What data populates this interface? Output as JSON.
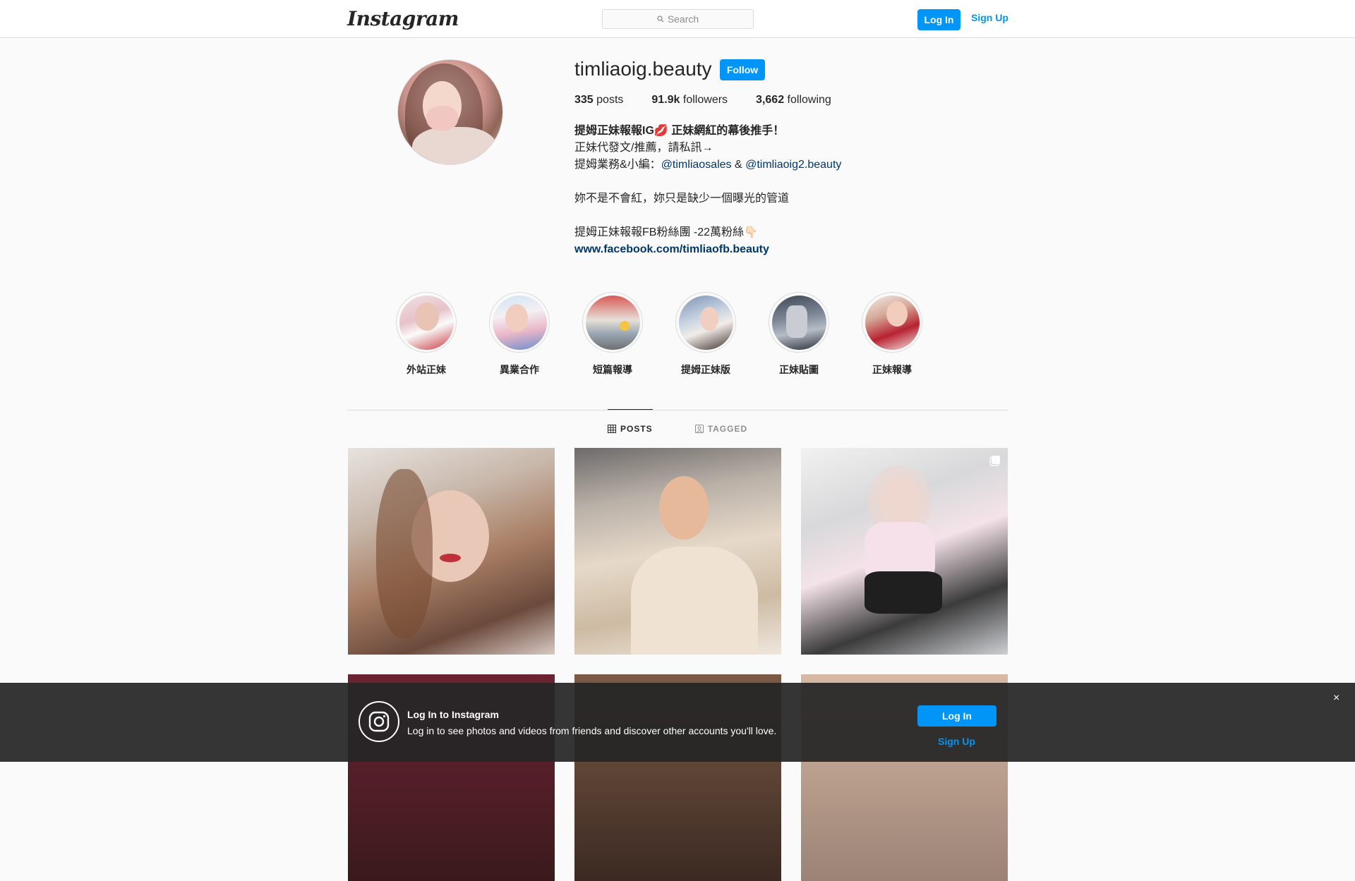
{
  "nav": {
    "logo": "Instagram",
    "search_placeholder": "Search",
    "login_label": "Log In",
    "signup_label": "Sign Up"
  },
  "profile": {
    "username": "timliaoig.beauty",
    "follow_label": "Follow",
    "stats": {
      "posts_count": "335",
      "posts_label": "posts",
      "followers_count": "91.9k",
      "followers_label": "followers",
      "following_count": "3,662",
      "following_label": "following"
    },
    "bio": {
      "line1": "提姆正妹報報IG💋 正妹網紅的幕後推手！",
      "line2": "正妹代發文/推薦，請私訊→",
      "line3_prefix": "提姆業務&小編：",
      "mention1": "@timliaosales",
      "line3_mid": " & ",
      "mention2": "@timliaoig2.beauty",
      "line4": "妳不是不會紅，妳只是缺少一個曝光的管道",
      "line5": "提姆正妹報報FB粉絲團 -22萬粉絲👇🏻",
      "website": "www.facebook.com/timliaofb.beauty"
    }
  },
  "highlights": [
    {
      "label": "外站正妹"
    },
    {
      "label": "異業合作"
    },
    {
      "label": "短篇報導"
    },
    {
      "label": "提姆正妹版"
    },
    {
      "label": "正妹貼圖"
    },
    {
      "label": "正妹報導"
    }
  ],
  "tabs": {
    "posts": "POSTS",
    "tagged": "TAGGED"
  },
  "banner": {
    "title": "Log In to Instagram",
    "text": "Log in to see photos and videos from friends and discover other accounts you'll love.",
    "login_label": "Log In",
    "signup_label": "Sign Up",
    "close_label": "×"
  },
  "colors": {
    "accent": "#0095f6",
    "link": "#00376b",
    "border": "#dbdbdb",
    "background": "#fafafa"
  }
}
